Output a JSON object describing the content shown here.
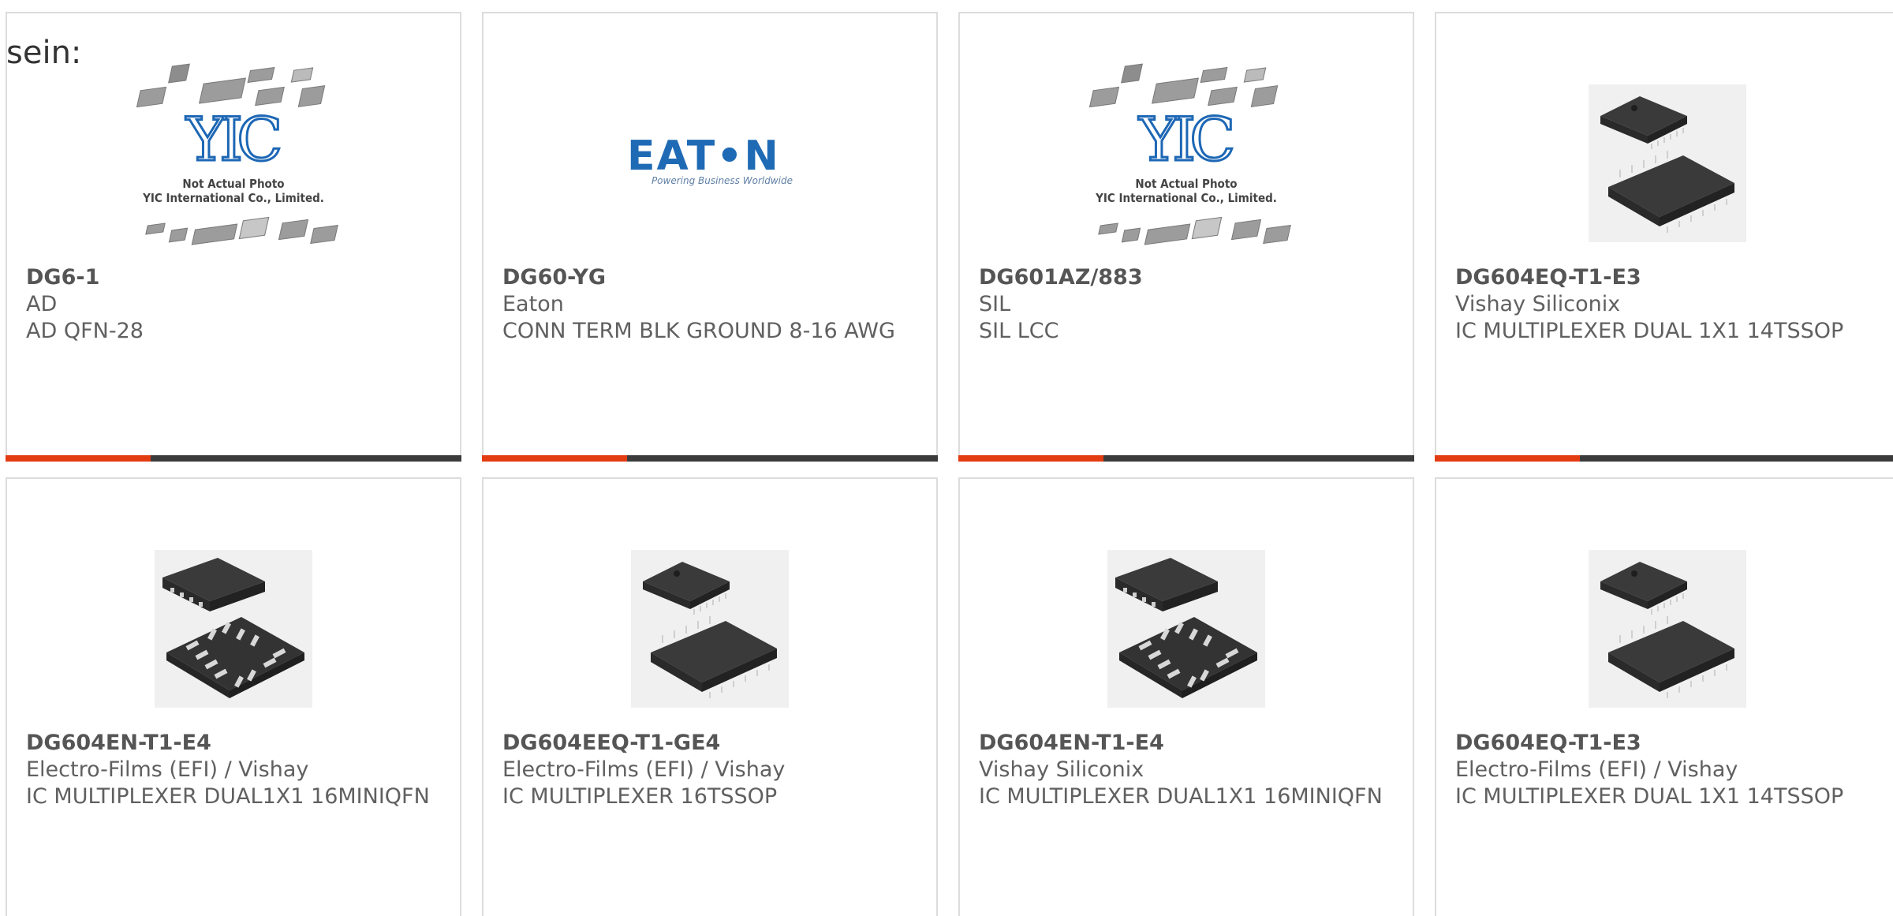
{
  "prefix_text": "sein:",
  "colors": {
    "accent": "#e33b12",
    "bar": "#3b3b3b",
    "yic_blue": "#1d67b5",
    "eaton_blue": "#1f6ab5"
  },
  "row1": [
    {
      "part_number": "DG6-1",
      "manufacturer": "AD",
      "description": "AD QFN-28",
      "image": "yic-placeholder",
      "image_caption_1": "Not Actual Photo",
      "image_caption_2": "YIC International Co., Limited.",
      "logo_text": "YIC"
    },
    {
      "part_number": "DG60-YG",
      "manufacturer": "Eaton",
      "description": "CONN TERM BLK GROUND 8-16 AWG",
      "image": "eaton-logo",
      "logo_text": "EAT•N",
      "logo_tagline": "Powering Business Worldwide"
    },
    {
      "part_number": "DG601AZ/883",
      "manufacturer": "SIL",
      "description": "SIL LCC",
      "image": "yic-placeholder",
      "image_caption_1": "Not Actual Photo",
      "image_caption_2": "YIC International Co., Limited.",
      "logo_text": "YIC"
    },
    {
      "part_number": "DG604EQ-T1-E3",
      "manufacturer": "Vishay Siliconix",
      "description": "IC MULTIPLEXER DUAL 1X1 14TSSOP",
      "image": "tssop-chip-photo"
    }
  ],
  "row2": [
    {
      "part_number": "DG604EN-T1-E4",
      "manufacturer": "Electro-Films (EFI) / Vishay",
      "description": "IC MULTIPLEXER DUAL1X1 16MINIQFN",
      "image": "qfn-chip-photo"
    },
    {
      "part_number": "DG604EEQ-T1-GE4",
      "manufacturer": "Electro-Films (EFI) / Vishay",
      "description": "IC MULTIPLEXER 16TSSOP",
      "image": "tssop-chip-photo"
    },
    {
      "part_number": "DG604EN-T1-E4",
      "manufacturer": "Vishay Siliconix",
      "description": "IC MULTIPLEXER DUAL1X1 16MINIQFN",
      "image": "qfn-chip-photo"
    },
    {
      "part_number": "DG604EQ-T1-E3",
      "manufacturer": "Electro-Films (EFI) / Vishay",
      "description": "IC MULTIPLEXER DUAL 1X1 14TSSOP",
      "image": "tssop-chip-photo"
    }
  ]
}
